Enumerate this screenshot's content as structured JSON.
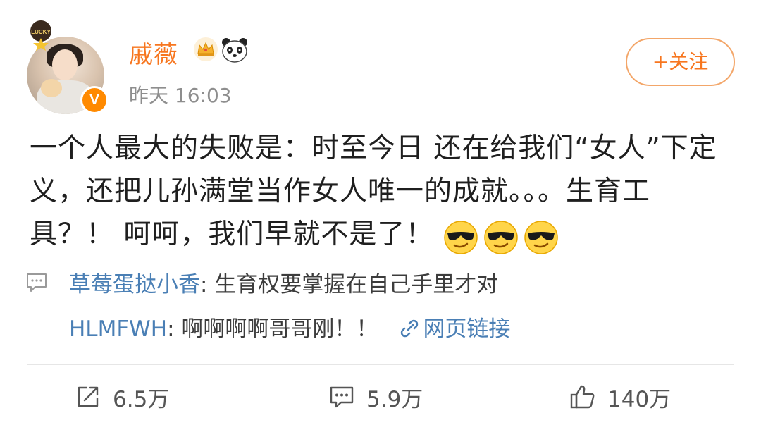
{
  "author": {
    "name": "戚薇",
    "timestamp": "昨天 16:03",
    "verified_label": "V",
    "avatar_badge_text": "LUCKY",
    "badges": [
      "crown-icon",
      "panda-icon"
    ]
  },
  "follow_button": {
    "label": "+关注"
  },
  "post": {
    "text": "一个人最大的失败是：时至今日 还在给我们“女人”下定义，还把儿孙满堂当作女人唯一的成就。。。生育工具？！ 呵呵，我们早就不是了！",
    "emojis": [
      "cool-emoji",
      "cool-emoji",
      "cool-emoji"
    ]
  },
  "comments": [
    {
      "author": "草莓蛋挞小香",
      "separator": ": ",
      "text": "生育权要掌握在自己手里才对"
    },
    {
      "author": "HLMFWH",
      "separator": ": ",
      "text": "啊啊啊啊哥哥刚！！",
      "link_label": "网页链接"
    }
  ],
  "actions": {
    "share_count": "6.5万",
    "comment_count": "5.9万",
    "like_count": "140万"
  },
  "colors": {
    "accent": "#f7761f",
    "link": "#4a7fb5",
    "verified": "#ff8a00"
  }
}
